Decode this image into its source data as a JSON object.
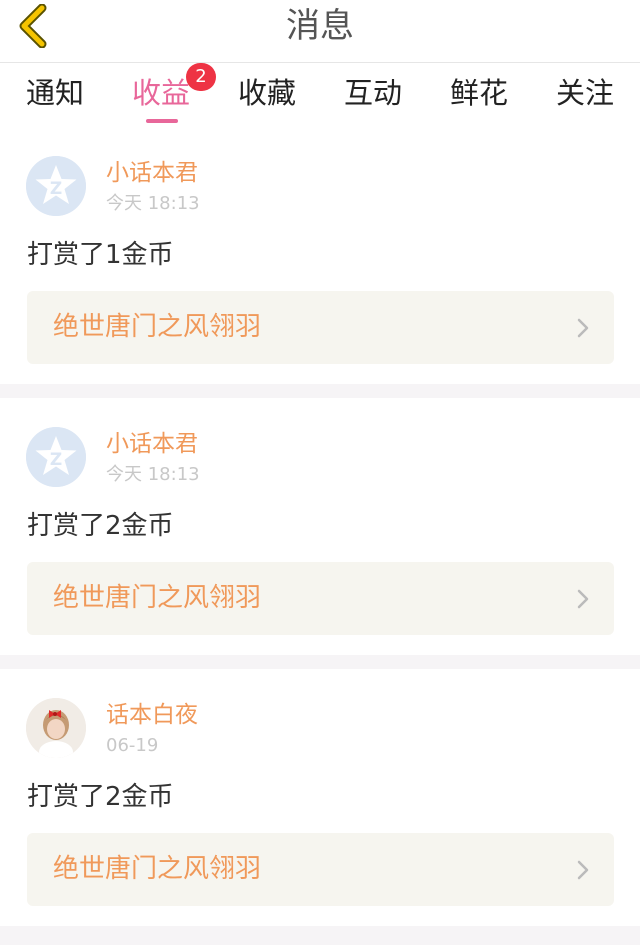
{
  "header": {
    "title": "消息",
    "back_icon": "chevron-left-icon",
    "back_icon_color": "#f5c400"
  },
  "tabs": [
    {
      "label": "通知",
      "active": false
    },
    {
      "label": "收益",
      "active": true,
      "badge": "2"
    },
    {
      "label": "收藏",
      "active": false
    },
    {
      "label": "互动",
      "active": false
    },
    {
      "label": "鲜花",
      "active": false
    },
    {
      "label": "关注",
      "active": false
    }
  ],
  "colors": {
    "accent": "#e8679a",
    "badge": "#ee3344",
    "username": "#f0995a",
    "work_title": "#f0995a",
    "link_background": "#f6f5ef"
  },
  "messages": [
    {
      "user": "小话本君",
      "time": "今天 18:13",
      "text": "打赏了1金币",
      "work": "绝世唐门之风翎羽",
      "avatar": "default-avatar-icon"
    },
    {
      "user": "小话本君",
      "time": "今天 18:13",
      "text": "打赏了2金币",
      "work": "绝世唐门之风翎羽",
      "avatar": "default-avatar-icon"
    },
    {
      "user": "话本白夜",
      "time": "06-19",
      "text": "打赏了2金币",
      "work": "绝世唐门之风翎羽",
      "avatar": "user-photo-avatar"
    }
  ]
}
